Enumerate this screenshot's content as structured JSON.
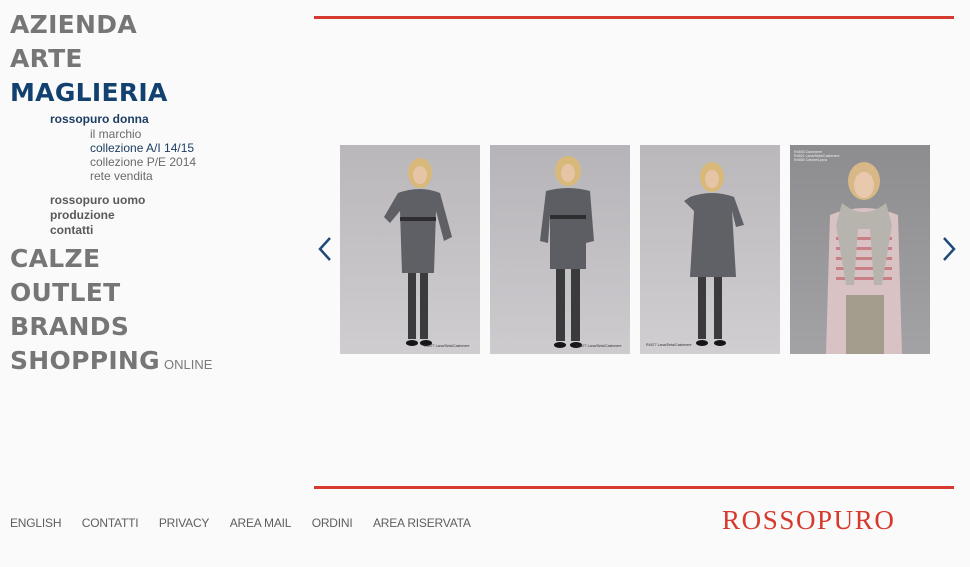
{
  "nav": {
    "main_items": [
      {
        "label": "AZIENDA"
      },
      {
        "label": "ARTE"
      },
      {
        "label": "MAGLIERIA"
      },
      {
        "label": "CALZE"
      },
      {
        "label": "OUTLET"
      },
      {
        "label": "BRANDS"
      },
      {
        "label": "SHOPPING",
        "suffix": "ONLINE"
      }
    ],
    "active_main": "MAGLIERIA",
    "sub_items": [
      {
        "label": "rossopuro donna"
      },
      {
        "label": "rossopuro uomo"
      },
      {
        "label": "produzione"
      },
      {
        "label": "contatti"
      }
    ],
    "subsub_items": [
      {
        "label": "il marchio"
      },
      {
        "label": "collezione A/I 14/15"
      },
      {
        "label": "collezione P/E 2014"
      },
      {
        "label": "rete vendita"
      }
    ]
  },
  "carousel": {
    "prev_icon": "chevron-left-icon",
    "next_icon": "chevron-right-icon",
    "photos": [
      {
        "caption": "R4577  Lana/Seta/Cashmere"
      },
      {
        "caption": "R4577  Lana/Seta/Cashmere"
      },
      {
        "caption": "R4577  Lana/Seta/Cashmere"
      },
      {
        "caption_lines": [
          "R4605  Cashmere",
          "R4621  Lana/Seta/Cashmere",
          "R4655  Cotone/Lycra"
        ]
      }
    ]
  },
  "footer": {
    "links": [
      "ENGLISH",
      "CONTATTI",
      "PRIVACY",
      "AREA MAIL",
      "ORDINI",
      "AREA RISERVATA"
    ]
  },
  "brand": {
    "logo_text": "ROSSOPURO"
  },
  "colors": {
    "accent_red": "#d63a2e",
    "active_blue": "#12416f",
    "nav_grey": "#767676"
  }
}
